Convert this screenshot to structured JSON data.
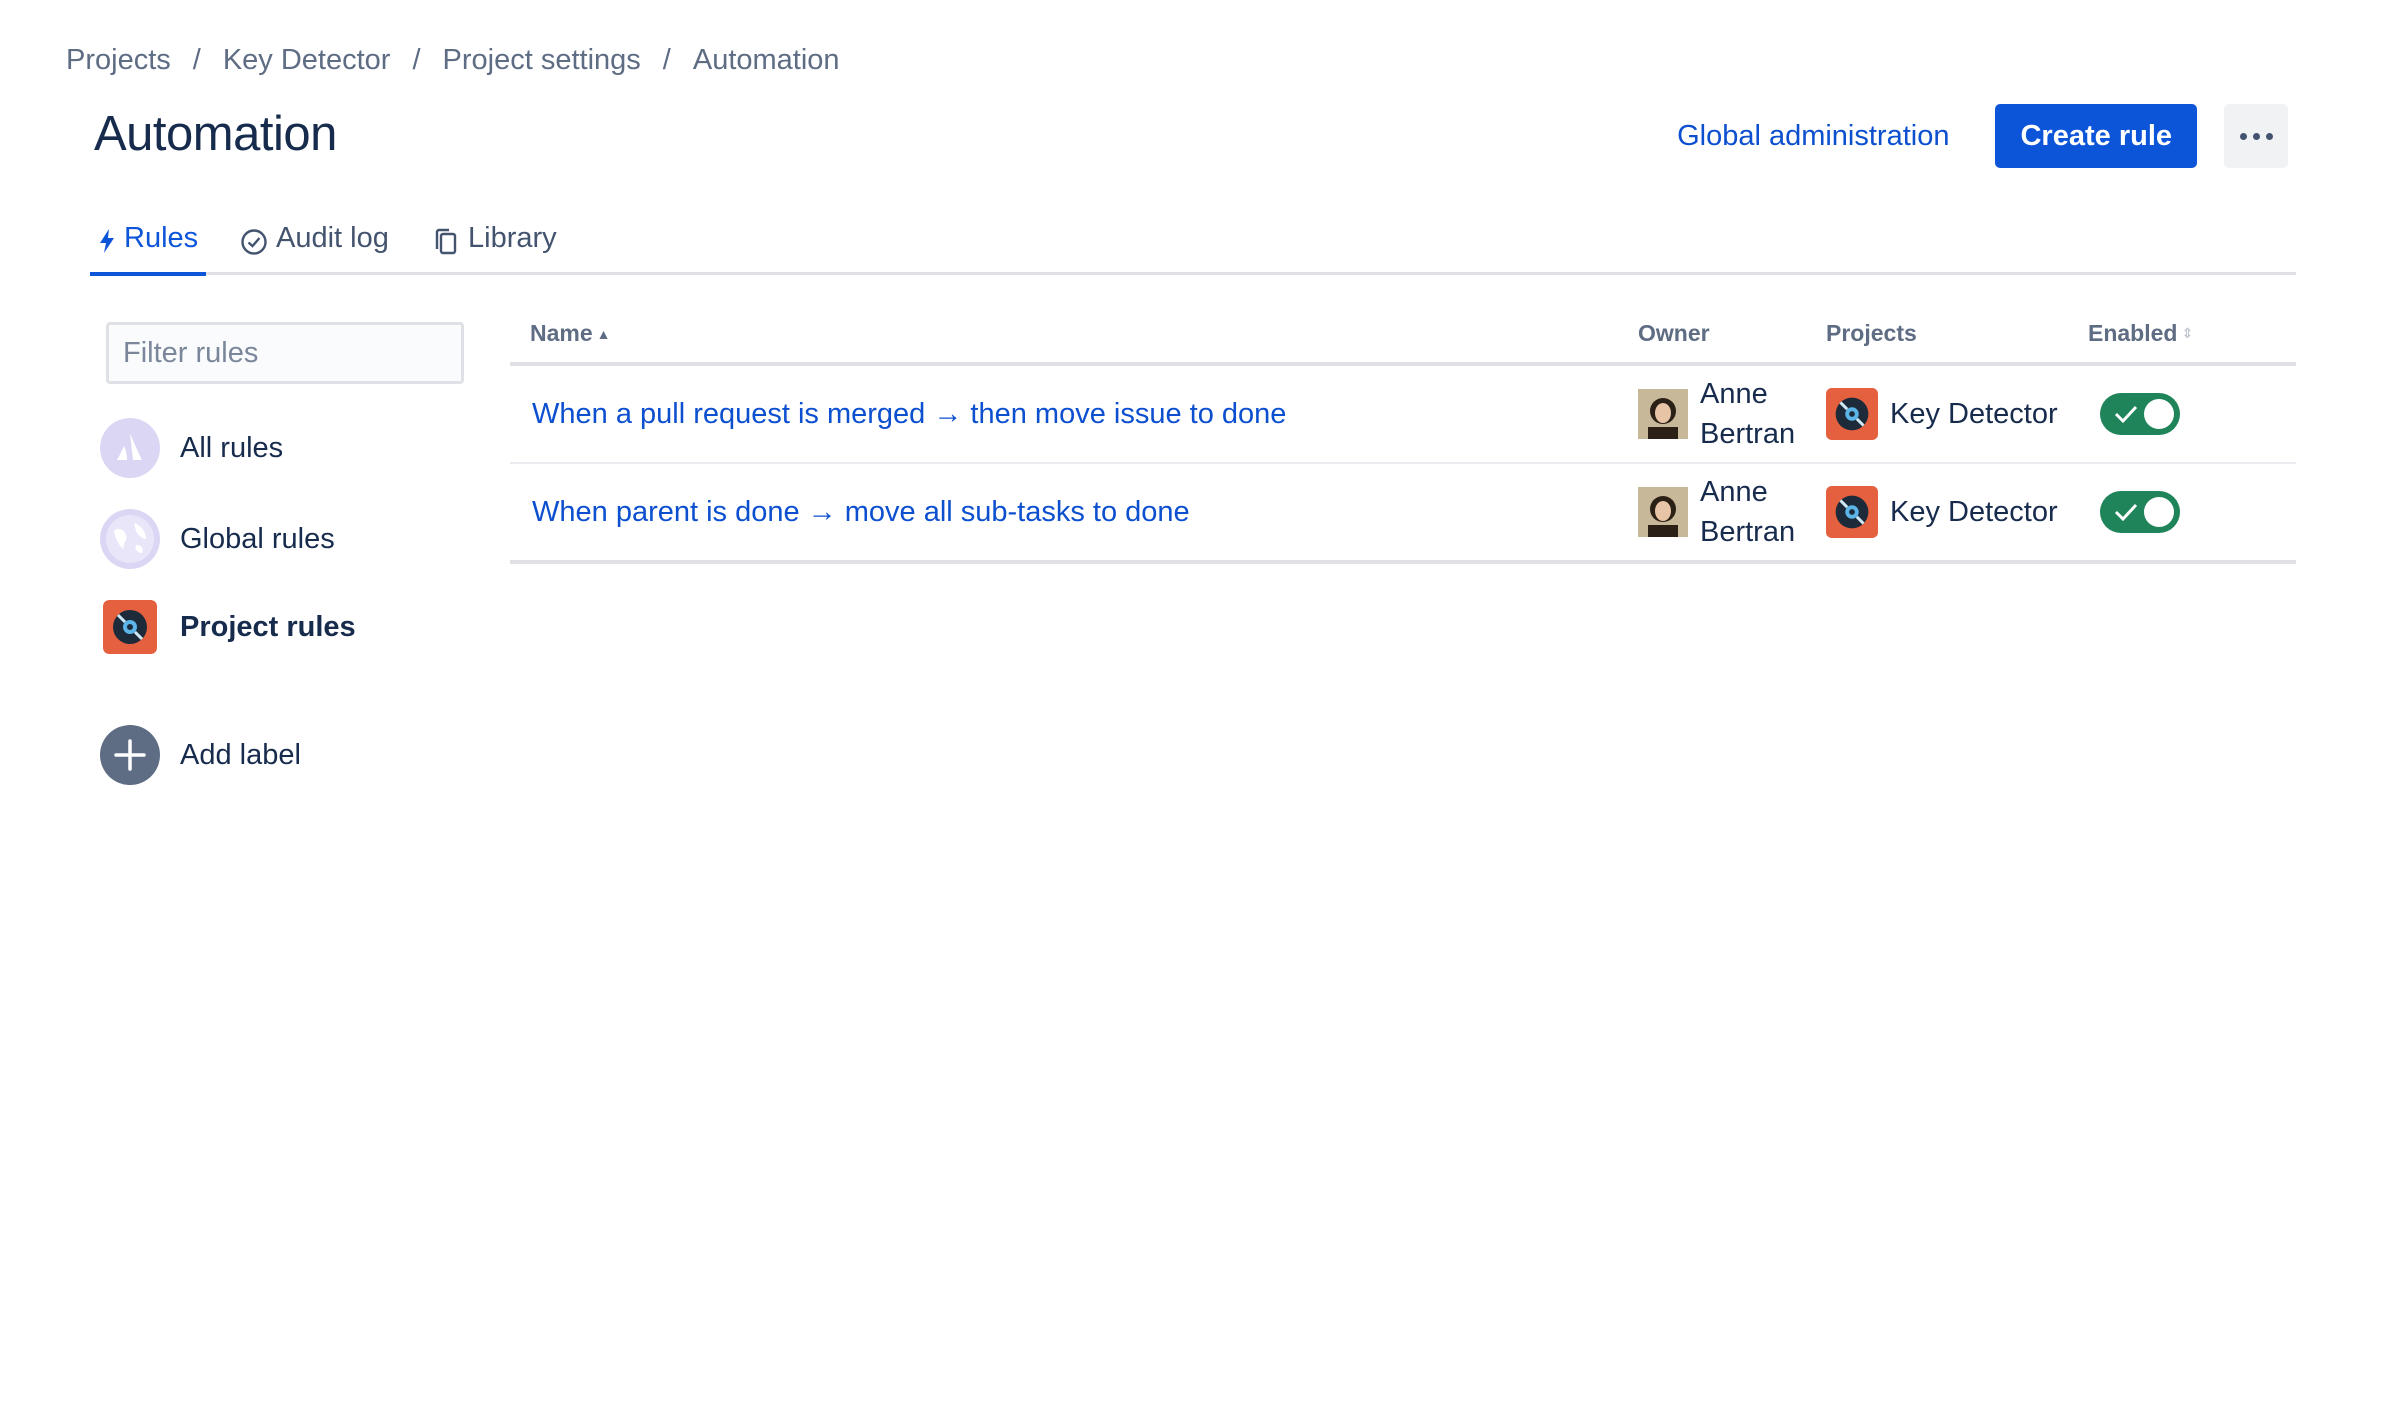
{
  "breadcrumb": [
    "Projects",
    "Key Detector",
    "Project settings",
    "Automation"
  ],
  "page": {
    "title": "Automation"
  },
  "header": {
    "global_admin": "Global administration",
    "create_rule": "Create rule"
  },
  "tabs": [
    {
      "label": "Rules",
      "icon": "bolt-icon",
      "active": true
    },
    {
      "label": "Audit log",
      "icon": "check-circle-icon"
    },
    {
      "label": "Library",
      "icon": "copy-icon"
    }
  ],
  "sidebar": {
    "filter_placeholder": "Filter rules",
    "items": [
      {
        "label": "All rules",
        "icon": "atlassian-logo-icon"
      },
      {
        "label": "Global rules",
        "icon": "globe-icon"
      },
      {
        "label": "Project rules",
        "icon": "project-avatar-icon"
      }
    ],
    "add_label": "Add label"
  },
  "table": {
    "columns": {
      "name": "Name",
      "owner": "Owner",
      "projects": "Projects",
      "enabled": "Enabled"
    },
    "rows": [
      {
        "name": "When a pull request is merged → then move issue to done",
        "owner": "Anne Bertran",
        "project": "Key Detector",
        "enabled": true
      },
      {
        "name": "When parent is done → move all sub-tasks to done",
        "owner": "Anne Bertran",
        "project": "Key Detector",
        "enabled": true
      }
    ]
  },
  "colors": {
    "primary": "#0c55d9",
    "link": "#0c4fcf",
    "toggle_on": "#1f845a",
    "project_icon": "#e5603f"
  }
}
